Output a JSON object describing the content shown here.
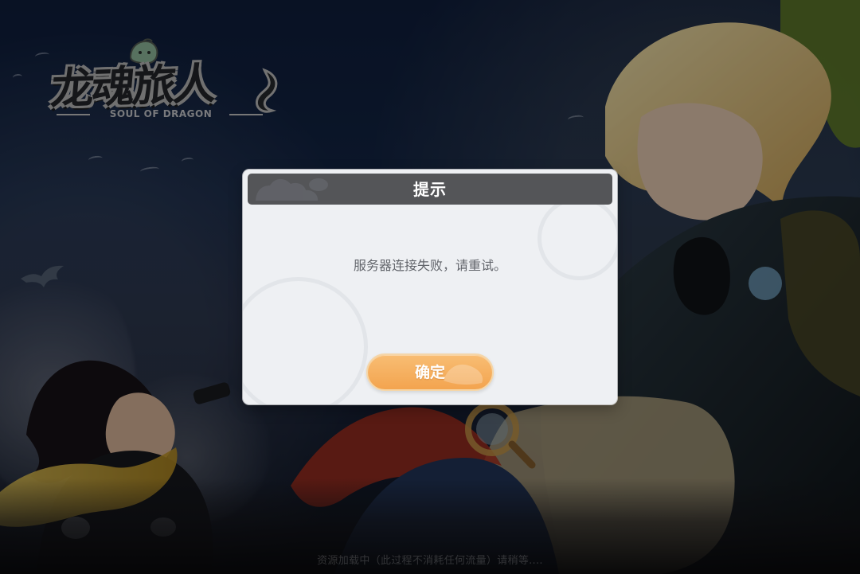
{
  "game": {
    "logo_title": "龙魂旅人",
    "logo_subtitle": "SOUL OF DRAGON"
  },
  "dialog": {
    "title": "提示",
    "message": "服务器连接失败，请重试。",
    "confirm_label": "确定"
  },
  "footer": {
    "loading_text": "资源加载中（此过程不消耗任何流量）请稍等...."
  },
  "colors": {
    "dialog_background": "#eef0f3",
    "dialog_header": "#545558",
    "confirm_button": "#f3a44f",
    "overlay": "#000000"
  },
  "icons": {
    "logo_mascot": "green-slime-icon",
    "logo_tail": "dragon-tail-icon",
    "watermark": "dragon-emblem-icon"
  }
}
